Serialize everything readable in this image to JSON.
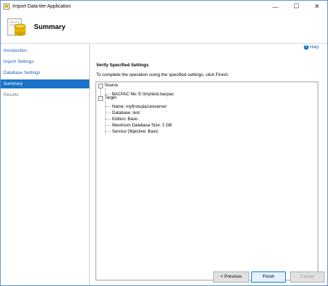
{
  "window": {
    "title": "Import Data-tier Application",
    "minimize_glyph": "—",
    "maximize_glyph": "☐",
    "close_glyph": "✕"
  },
  "header": {
    "title": "Summary"
  },
  "sidebar": {
    "items": [
      {
        "label": "Introduction",
        "state": "link"
      },
      {
        "label": "Import Settings",
        "state": "link"
      },
      {
        "label": "Database Settings",
        "state": "link"
      },
      {
        "label": "Summary",
        "state": "active"
      },
      {
        "label": "Results",
        "state": "disabled"
      }
    ]
  },
  "main": {
    "help_label": "Help",
    "section_title": "Verify Specified Settings",
    "instruction": "To complete the operation using the specified settings, click Finish.",
    "tree": {
      "source": {
        "label": "Source",
        "children": [
          "BACPAC file: E:\\tmp\\test.bacpac"
        ]
      },
      "target": {
        "label": "Target",
        "children": [
          "Name: myfirstsqlazureserver",
          "Database: test",
          "Edition: Basic",
          "Maximum Database Size: 2 GB",
          "Service Objective: Basic"
        ]
      }
    }
  },
  "footer": {
    "previous_label": "< Previous",
    "finish_label": "Finish",
    "cancel_label": "Cancel"
  },
  "colors": {
    "accent": "#1a73c8",
    "link": "#1a5fb4"
  }
}
